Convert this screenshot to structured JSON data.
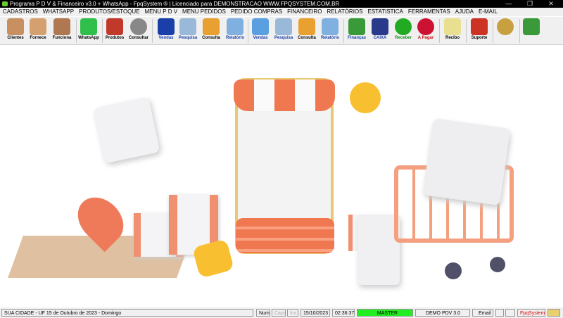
{
  "window": {
    "title": "Programa P D V & Financeiro v3.0 + WhatsApp - FpqSystem ® | Licenciado para  DEMONSTRACAO WWW.FPQSYSTEM.COM.BR",
    "minimize": "—",
    "maximize": "❐",
    "close": "✕"
  },
  "menu": [
    "CADASTROS",
    "WHATSAPP",
    "PRODUTOS/ESTOQUE",
    "MENU P D V",
    "MENU PEDIDOS",
    "PEDIDO COMPRAS",
    "FINANCEIRO",
    "RELATÓRIOS",
    "ESTATISTICA",
    "FERRAMENTAS",
    "AJUDA",
    "E-MAIL"
  ],
  "toolbar": [
    {
      "label": "Clientes",
      "color": "#c89060",
      "text": "#000"
    },
    {
      "label": "Fornece",
      "color": "#d4a070",
      "text": "#000"
    },
    {
      "label": "Funciona",
      "color": "#b07850",
      "text": "#000"
    },
    {
      "label": "WhatsApp",
      "color": "#2fbf4a",
      "text": "#000"
    },
    {
      "label": "Produtos",
      "color": "#c0392b",
      "text": "#000"
    },
    {
      "label": "Consultar",
      "color": "#888888",
      "text": "#000"
    },
    {
      "label": "Vendas",
      "color": "#1a3fa8",
      "text": "#1a3fa8"
    },
    {
      "label": "Pesquisa",
      "color": "#9ab8d8",
      "text": "#1a3fa8"
    },
    {
      "label": "Consulta",
      "color": "#e8a030",
      "text": "#000"
    },
    {
      "label": "Relatório",
      "color": "#80b0e0",
      "text": "#1a3fa8"
    },
    {
      "label": "Vendas",
      "color": "#5aa0e0",
      "text": "#1a3fa8"
    },
    {
      "label": "Pesquisa",
      "color": "#9ab8d8",
      "text": "#1a3fa8"
    },
    {
      "label": "Consulta",
      "color": "#e8a030",
      "text": "#000"
    },
    {
      "label": "Relatório",
      "color": "#80b0e0",
      "text": "#1a3fa8"
    },
    {
      "label": "Finanças",
      "color": "#3a9a3a",
      "text": "#1a3fa8"
    },
    {
      "label": "CAIXA",
      "color": "#2a3a8a",
      "text": "#1a3fa8"
    },
    {
      "label": "Receber",
      "color": "#22aa22",
      "text": "#1a8a1a"
    },
    {
      "label": "A Pagar",
      "color": "#cc1133",
      "text": "#cc1111"
    },
    {
      "label": "Recibo",
      "color": "#e8e090",
      "text": "#000"
    },
    {
      "label": "Suporte",
      "color": "#cc3322",
      "text": "#000"
    },
    {
      "label": "",
      "color": "#c8a040",
      "text": "#000"
    },
    {
      "label": "",
      "color": "#3a9a3a",
      "text": "#000"
    }
  ],
  "status": {
    "location": "SUA CIDADE - UF 15 de Outubro de 2023 - Domingo",
    "num": "Num",
    "caps": "Caps",
    "ins": "Ins",
    "date": "15/10/2023",
    "time": "02:36:37",
    "user": "MASTER",
    "version": "DEMO PDV 3.0",
    "email": "Email",
    "brand": "FpqSystem"
  }
}
